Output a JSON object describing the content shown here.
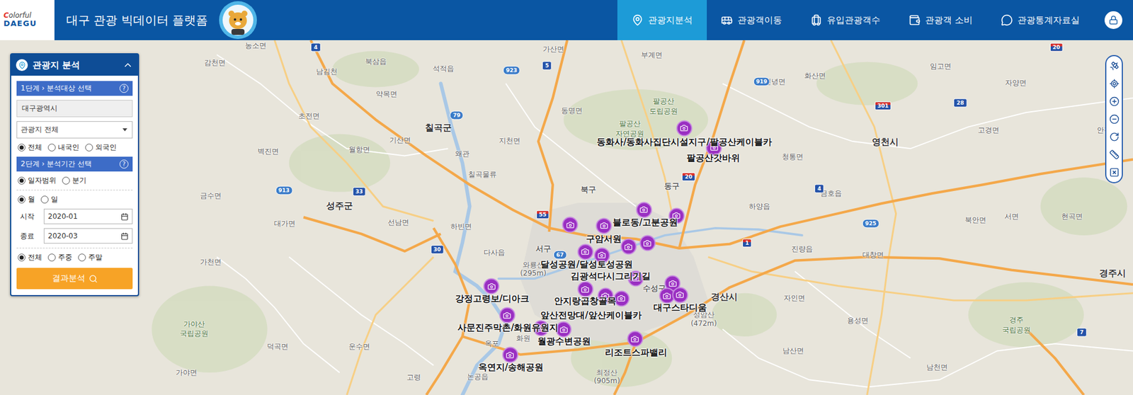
{
  "header": {
    "logo_top": "Colorful",
    "logo_bottom": "DAEGU",
    "title": "대구 관광 빅데이터 플랫폼"
  },
  "nav": [
    {
      "label": "관광지분석",
      "selected": true
    },
    {
      "label": "관광객이동",
      "selected": false
    },
    {
      "label": "유입관광객수",
      "selected": false
    },
    {
      "label": "관광객 소비",
      "selected": false
    },
    {
      "label": "관광통계자료실",
      "selected": false
    }
  ],
  "panel": {
    "title": "관광지 분석",
    "expanded": true,
    "step1": {
      "label": "1단계 › 분석대상 선택",
      "help": "?"
    },
    "region": "대구광역시",
    "category": "관광지 전체",
    "visitor_type": [
      {
        "label": "전체",
        "selected": true
      },
      {
        "label": "내국인",
        "selected": false
      },
      {
        "label": "외국인",
        "selected": false
      }
    ],
    "step2": {
      "label": "2단계 › 분석기간 선택",
      "help": "?"
    },
    "period_type": [
      {
        "label": "일자범위",
        "selected": true
      },
      {
        "label": "분기",
        "selected": false
      }
    ],
    "unit": [
      {
        "label": "월",
        "selected": true
      },
      {
        "label": "일",
        "selected": false
      }
    ],
    "dates": [
      {
        "label": "시작",
        "value": "2020-01"
      },
      {
        "label": "종료",
        "value": "2020-03"
      }
    ],
    "day_type": [
      {
        "label": "전체",
        "selected": true
      },
      {
        "label": "주중",
        "selected": false
      },
      {
        "label": "주말",
        "selected": false
      }
    ],
    "submit": "결과분석"
  },
  "map": {
    "places": [
      {
        "name": "농소면",
        "kind": "town"
      },
      {
        "name": "감천면",
        "kind": "town"
      },
      {
        "name": "남김천",
        "kind": "town"
      },
      {
        "name": "북삼읍",
        "kind": "town"
      },
      {
        "name": "석적읍",
        "kind": "town"
      },
      {
        "name": "가산면",
        "kind": "town"
      },
      {
        "name": "부계면",
        "kind": "town"
      },
      {
        "name": "약목면",
        "kind": "town"
      },
      {
        "name": "초전면",
        "kind": "town"
      },
      {
        "name": "칠곡군",
        "kind": "city"
      },
      {
        "name": "벽진면",
        "kind": "town"
      },
      {
        "name": "월항면",
        "kind": "town"
      },
      {
        "name": "기산면",
        "kind": "town"
      },
      {
        "name": "지천면",
        "kind": "town"
      },
      {
        "name": "왜관",
        "kind": "town"
      },
      {
        "name": "동명면",
        "kind": "town"
      },
      {
        "name": "팔공산",
        "kind": "park"
      },
      {
        "name": "도립공원",
        "kind": "park"
      },
      {
        "name": "팔공산",
        "kind": "park"
      },
      {
        "name": "자연공원",
        "kind": "park"
      },
      {
        "name": "칠곡물류",
        "kind": "town"
      },
      {
        "name": "북구",
        "kind": "district"
      },
      {
        "name": "동구",
        "kind": "district"
      },
      {
        "name": "성주군",
        "kind": "city"
      },
      {
        "name": "선남면",
        "kind": "town"
      },
      {
        "name": "대가면",
        "kind": "town"
      },
      {
        "name": "금수면",
        "kind": "town"
      },
      {
        "name": "하빈면",
        "kind": "town"
      },
      {
        "name": "다사읍",
        "kind": "town"
      },
      {
        "name": "서구",
        "kind": "district"
      },
      {
        "name": "가천면",
        "kind": "town"
      },
      {
        "name": "와룡산",
        "kind": "peak"
      },
      {
        "name": "(295m)",
        "kind": "peak"
      },
      {
        "name": "수성구",
        "kind": "district"
      },
      {
        "name": "경산시",
        "kind": "city"
      },
      {
        "name": "성암산",
        "kind": "peak"
      },
      {
        "name": "(472m)",
        "kind": "peak"
      },
      {
        "name": "최정산",
        "kind": "peak"
      },
      {
        "name": "(905m)",
        "kind": "peak"
      },
      {
        "name": "하양읍",
        "kind": "town"
      },
      {
        "name": "영천시",
        "kind": "city"
      },
      {
        "name": "화산면",
        "kind": "town"
      },
      {
        "name": "신녕면",
        "kind": "town"
      },
      {
        "name": "청통면",
        "kind": "town"
      },
      {
        "name": "금호읍",
        "kind": "town"
      },
      {
        "name": "고경면",
        "kind": "town"
      },
      {
        "name": "임고면",
        "kind": "town"
      },
      {
        "name": "자양면",
        "kind": "town"
      },
      {
        "name": "북안면",
        "kind": "town"
      },
      {
        "name": "서면",
        "kind": "town"
      },
      {
        "name": "경주시",
        "kind": "city"
      },
      {
        "name": "진량읍",
        "kind": "town"
      },
      {
        "name": "자인면",
        "kind": "town"
      },
      {
        "name": "용성면",
        "kind": "town"
      },
      {
        "name": "남산면",
        "kind": "town"
      },
      {
        "name": "남천면",
        "kind": "town"
      },
      {
        "name": "가야산",
        "kind": "park"
      },
      {
        "name": "국립공원",
        "kind": "park"
      },
      {
        "name": "가야면",
        "kind": "town"
      },
      {
        "name": "덕곡면",
        "kind": "town"
      },
      {
        "name": "운수면",
        "kind": "town"
      },
      {
        "name": "옥포",
        "kind": "town"
      },
      {
        "name": "화원",
        "kind": "town"
      },
      {
        "name": "논공읍",
        "kind": "town"
      },
      {
        "name": "고령",
        "kind": "town"
      },
      {
        "name": "안강읍",
        "kind": "town"
      },
      {
        "name": "현곡면",
        "kind": "town"
      },
      {
        "name": "대창면",
        "kind": "town"
      },
      {
        "name": "경주",
        "kind": "park"
      },
      {
        "name": "국립공원",
        "kind": "park"
      }
    ],
    "routes": [
      {
        "number": "4",
        "kind": "national"
      },
      {
        "number": "5",
        "kind": "national"
      },
      {
        "number": "923",
        "kind": "provincial"
      },
      {
        "number": "79",
        "kind": "provincial"
      },
      {
        "number": "33",
        "kind": "national"
      },
      {
        "number": "913",
        "kind": "provincial"
      },
      {
        "number": "30",
        "kind": "national"
      },
      {
        "number": "55",
        "kind": "expressway"
      },
      {
        "number": "67",
        "kind": "provincial"
      },
      {
        "number": "20",
        "kind": "expressway"
      },
      {
        "number": "919",
        "kind": "provincial"
      },
      {
        "number": "28",
        "kind": "national"
      },
      {
        "number": "301",
        "kind": "expressway"
      },
      {
        "number": "4",
        "kind": "national"
      },
      {
        "number": "1",
        "kind": "expressway"
      },
      {
        "number": "925",
        "kind": "provincial"
      },
      {
        "number": "7",
        "kind": "national"
      },
      {
        "number": "20",
        "kind": "expressway"
      }
    ],
    "pois": [
      {
        "name": "동화사/동화사집단시설지구/팔공산케이블카"
      },
      {
        "name": "팔공산갓바위"
      },
      {
        "name": "블로동/고분공원"
      },
      {
        "name": "구암서원"
      },
      {
        "name": "달성공원/달성토성공원"
      },
      {
        "name": "김광석다시그리기길"
      },
      {
        "name": "강정고령보/디아크"
      },
      {
        "name": "안지랑곱창골목"
      },
      {
        "name": "대구스타디움"
      },
      {
        "name": "앞산전망대/앞산케이블카"
      },
      {
        "name": "사문진주막촌/화원유원지"
      },
      {
        "name": "월광수변공원"
      },
      {
        "name": "리조트스파밸리"
      },
      {
        "name": "옥연지/송해공원"
      }
    ]
  }
}
